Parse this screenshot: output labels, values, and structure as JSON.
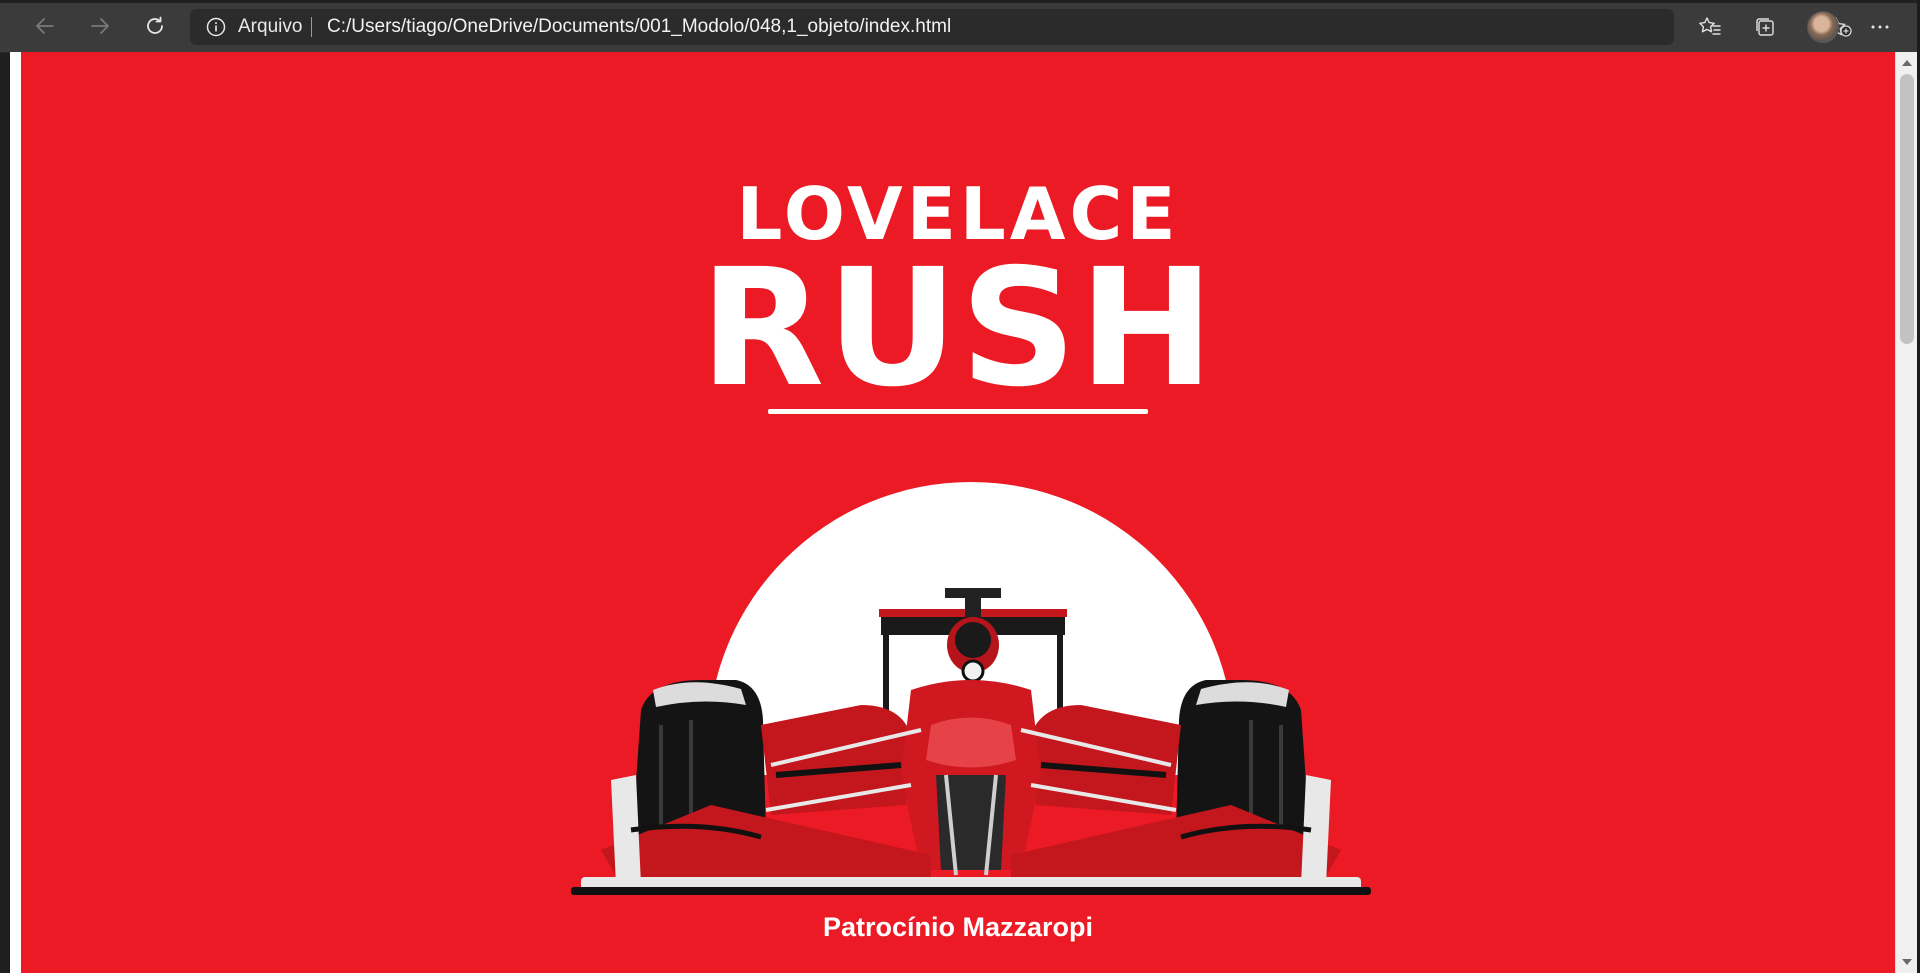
{
  "browser": {
    "address": {
      "scheme_label": "Arquivo",
      "url": "C:/Users/tiago/OneDrive/Documents/001_Modolo/048,1_objeto/index.html"
    },
    "icons": {
      "back": "arrow-left-icon",
      "forward": "arrow-right-icon",
      "refresh": "refresh-icon",
      "info": "info-icon",
      "add_favorite": "star-plus-icon",
      "favorites": "favorites-icon",
      "collections": "collections-icon",
      "profile": "avatar",
      "menu": "more-horizontal-icon"
    }
  },
  "page": {
    "title_line1": "LOVELACE",
    "title_line2": "RUSH",
    "author": "Patrocínio Mazzaropi",
    "background_color": "#ec1a24",
    "accent_color": "#ffffff"
  }
}
